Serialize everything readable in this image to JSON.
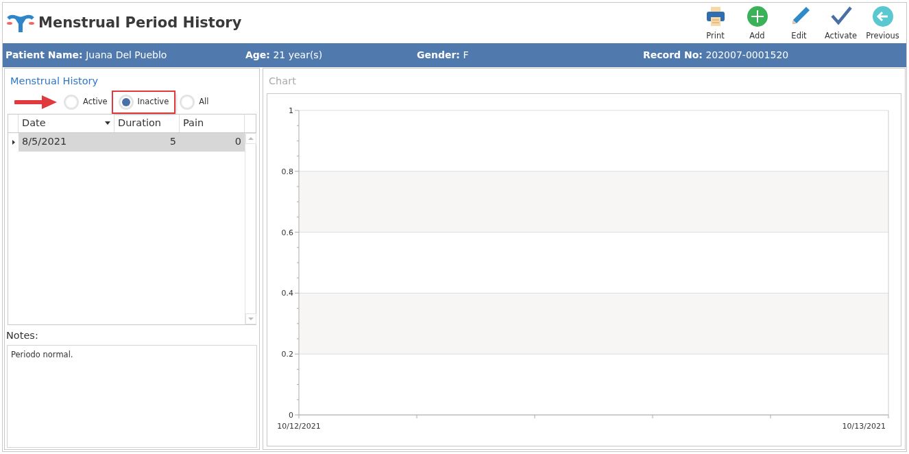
{
  "window": {
    "title": "Menstrual Period History"
  },
  "toolbar": [
    {
      "kind": "print",
      "label": "Print"
    },
    {
      "kind": "add",
      "label": "Add"
    },
    {
      "kind": "edit",
      "label": "Edit"
    },
    {
      "kind": "activate",
      "label": "Activate"
    },
    {
      "kind": "previous",
      "label": "Previous"
    }
  ],
  "patient_bar": [
    {
      "label": "Patient Name:",
      "value": "Juana Del Pueblo"
    },
    {
      "label": "Age:",
      "value": "21 year(s)"
    },
    {
      "label": "Gender:",
      "value": "F"
    },
    {
      "label": "Record No:",
      "value": "202007-0001520"
    }
  ],
  "history": {
    "title": "Menstrual History",
    "filters": [
      {
        "label": "Active",
        "selected": false
      },
      {
        "label": "Inactive",
        "selected": true,
        "highlighted": true
      },
      {
        "label": "All",
        "selected": false
      }
    ],
    "table": {
      "columns": [
        "Date",
        "Duration",
        "Pain"
      ],
      "rows": [
        {
          "selected": true,
          "cells": [
            "8/5/2021",
            "5",
            "0"
          ]
        }
      ]
    },
    "notes_label": "Notes:",
    "notes": "Periodo normal."
  },
  "chart_panel": {
    "title": "Chart",
    "chart_data": {
      "type": "line",
      "ylim": [
        0,
        1
      ],
      "yticks": [
        0,
        0.2,
        0.4,
        0.6,
        0.8,
        1
      ],
      "categories": [
        "10/12/2021",
        "10/13/2021"
      ]
    }
  }
}
